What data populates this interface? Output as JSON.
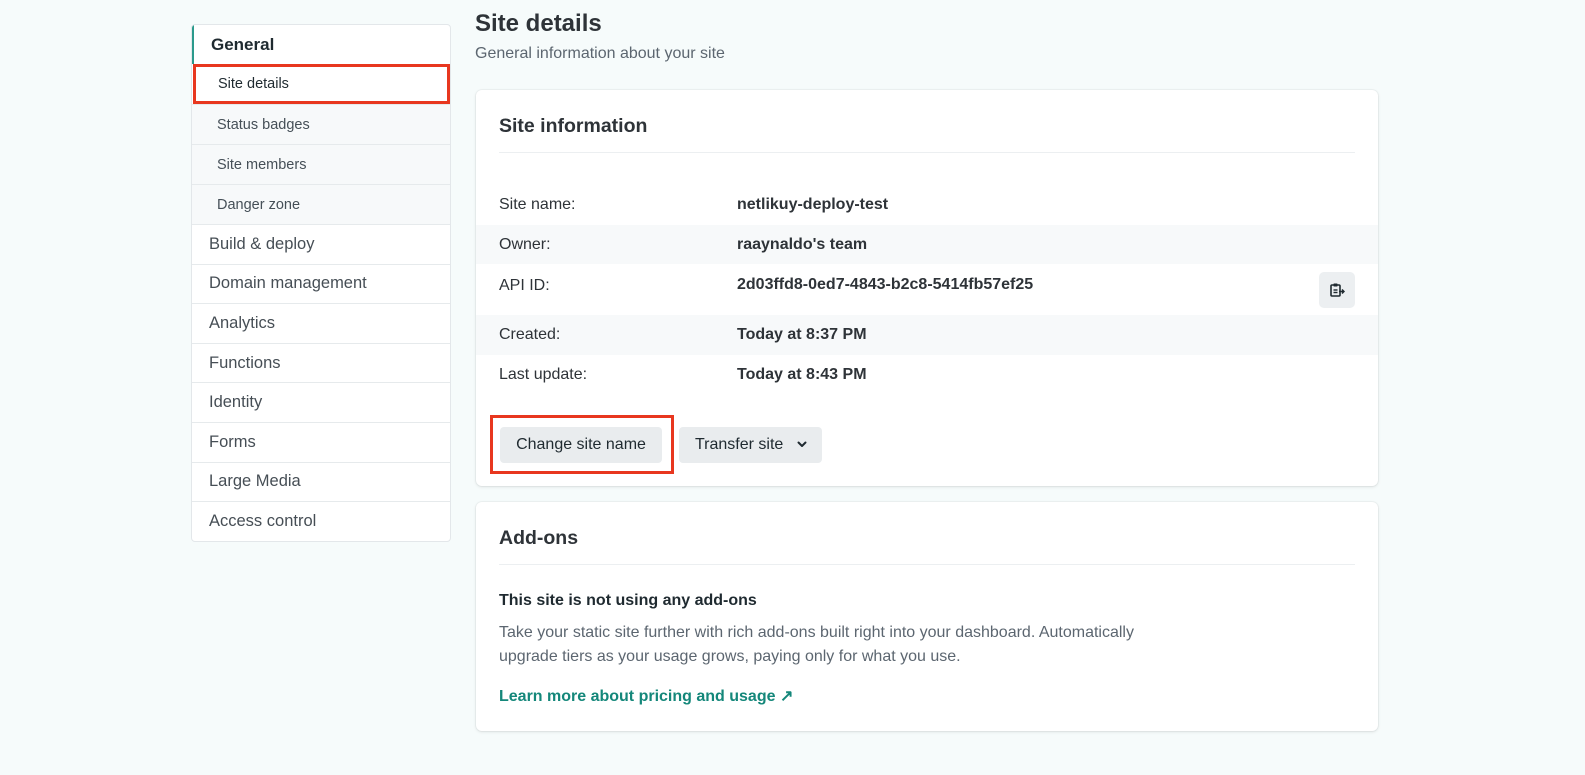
{
  "sidebar": {
    "section": "General",
    "sub_items": [
      {
        "label": "Site details"
      },
      {
        "label": "Status badges"
      },
      {
        "label": "Site members"
      },
      {
        "label": "Danger zone"
      }
    ],
    "items": [
      {
        "label": "Build & deploy"
      },
      {
        "label": "Domain management"
      },
      {
        "label": "Analytics"
      },
      {
        "label": "Functions"
      },
      {
        "label": "Identity"
      },
      {
        "label": "Forms"
      },
      {
        "label": "Large Media"
      },
      {
        "label": "Access control"
      }
    ]
  },
  "header": {
    "title": "Site details",
    "subtitle": "General information about your site"
  },
  "site_info": {
    "title": "Site information",
    "rows": [
      {
        "label": "Site name:",
        "value": "netlikuy-deploy-test"
      },
      {
        "label": "Owner:",
        "value": "raaynaldo's team"
      },
      {
        "label": "API ID:",
        "value": "2d03ffd8-0ed7-4843-b2c8-5414fb57ef25"
      },
      {
        "label": "Created:",
        "value": "Today at 8:37 PM"
      },
      {
        "label": "Last update:",
        "value": "Today at 8:43 PM"
      }
    ],
    "change_name_label": "Change site name",
    "transfer_label": "Transfer site"
  },
  "addons": {
    "title": "Add-ons",
    "heading": "This site is not using any add-ons",
    "description": "Take your static site further with rich add-ons built right into your dashboard. Automatically upgrade tiers as your usage grows, paying only for what you use.",
    "link_label": "Learn more about pricing and usage ↗"
  },
  "colors": {
    "accent": "#14877a",
    "highlight": "#e8371f",
    "background": "#f6fbfb"
  }
}
